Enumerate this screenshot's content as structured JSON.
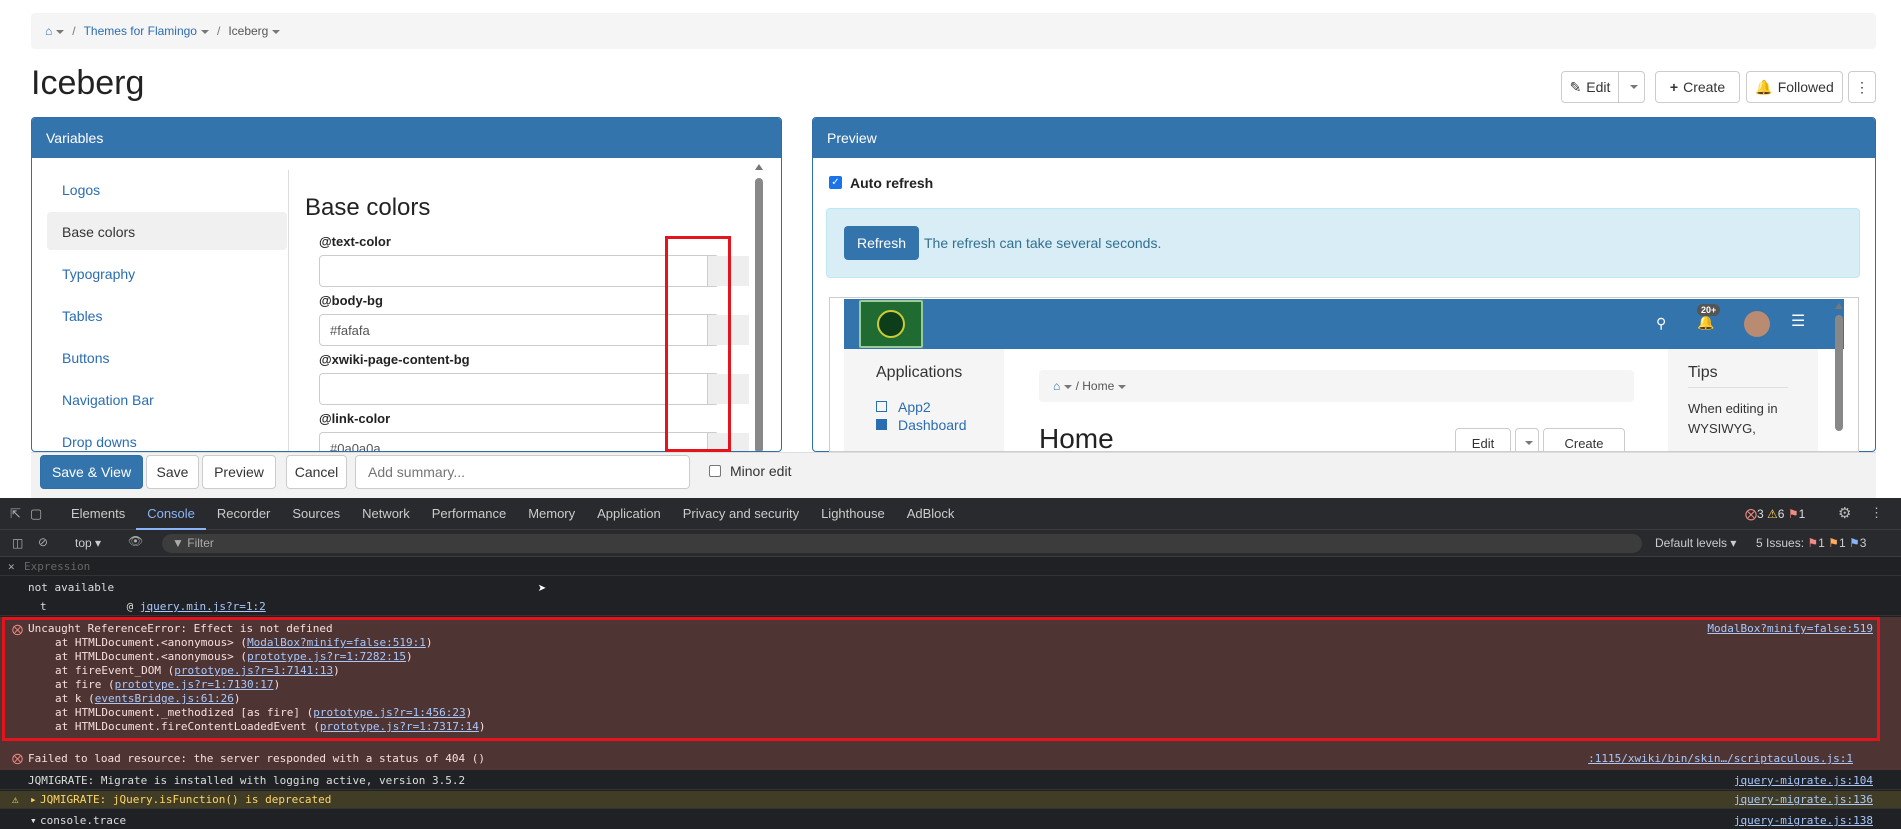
{
  "breadcrumb": {
    "parent": "Themes for Flamingo",
    "current": "Iceberg"
  },
  "page_title": "Iceberg",
  "actions": {
    "edit": "Edit",
    "create": "Create",
    "followed": "Followed"
  },
  "variables_panel": {
    "title": "Variables",
    "nav": [
      "Logos",
      "Base colors",
      "Typography",
      "Tables",
      "Buttons",
      "Navigation Bar",
      "Drop downs"
    ],
    "section_title": "Base colors",
    "vars": [
      {
        "label": "@text-color",
        "value": ""
      },
      {
        "label": "@body-bg",
        "value": "#fafafa"
      },
      {
        "label": "@xwiki-page-content-bg",
        "value": ""
      },
      {
        "label": "@link-color",
        "value": "#0a0a0a"
      }
    ]
  },
  "preview_panel": {
    "title": "Preview",
    "auto_refresh": "Auto refresh",
    "refresh_button": "Refresh",
    "refresh_note": "The refresh can take several seconds.",
    "badge": "20+",
    "apps_title": "Applications",
    "apps": [
      "App2",
      "Dashboard"
    ],
    "home_bc": "Home",
    "home_title": "Home",
    "tips_title": "Tips",
    "tips_text": "When editing in WYSIWYG,",
    "inner_edit": "Edit",
    "inner_create": "Create"
  },
  "edit_bar": {
    "save_view": "Save & View",
    "save": "Save",
    "preview": "Preview",
    "cancel": "Cancel",
    "summary_placeholder": "Add summary...",
    "minor_edit": "Minor edit"
  },
  "devtools": {
    "tabs": [
      "Elements",
      "Console",
      "Recorder",
      "Sources",
      "Network",
      "Performance",
      "Memory",
      "Application",
      "Privacy and security",
      "Lighthouse",
      "AdBlock"
    ],
    "counts": {
      "errors": "3",
      "warnings": "6",
      "info": "1"
    },
    "context": "top",
    "filter_placeholder": "Filter",
    "levels": "Default levels",
    "issues_label": "5 Issues:",
    "issue_counts": [
      "1",
      "1",
      "3"
    ],
    "expression": "Expression",
    "not_available": "not available",
    "trace_line": {
      "fn": "t",
      "at": "@",
      "link": "jquery.min.js?r=1:2"
    },
    "error1": {
      "message": "Uncaught ReferenceError: Effect is not defined",
      "source": "ModalBox?minify=false:519",
      "stack": [
        {
          "pre": "at HTMLDocument.<anonymous> (",
          "link": "ModalBox?minify=false:519:1",
          "post": ")"
        },
        {
          "pre": "at HTMLDocument.<anonymous> (",
          "link": "prototype.js?r=1:7282:15",
          "post": ")"
        },
        {
          "pre": "at fireEvent_DOM (",
          "link": "prototype.js?r=1:7141:13",
          "post": ")"
        },
        {
          "pre": "at fire (",
          "link": "prototype.js?r=1:7130:17",
          "post": ")"
        },
        {
          "pre": "at k (",
          "link": "eventsBridge.js:61:26",
          "post": ")"
        },
        {
          "pre": "at HTMLDocument._methodized [as fire] (",
          "link": "prototype.js?r=1:456:23",
          "post": ")"
        },
        {
          "pre": "at HTMLDocument.fireContentLoadedEvent (",
          "link": "prototype.js?r=1:7317:14",
          "post": ")"
        }
      ]
    },
    "error2": {
      "message": "Failed to load resource: the server responded with a status of 404 ()",
      "source": ":1115/xwiki/bin/skin…/scriptaculous.js:1"
    },
    "log1": {
      "message": "JQMIGRATE: Migrate is installed with logging active, version 3.5.2",
      "source": "jquery-migrate.js:104"
    },
    "warn1": {
      "message": "JQMIGRATE: jQuery.isFunction() is deprecated",
      "source": "jquery-migrate.js:136"
    },
    "log2": {
      "message": "console.trace",
      "source": "jquery-migrate.js:138"
    }
  }
}
